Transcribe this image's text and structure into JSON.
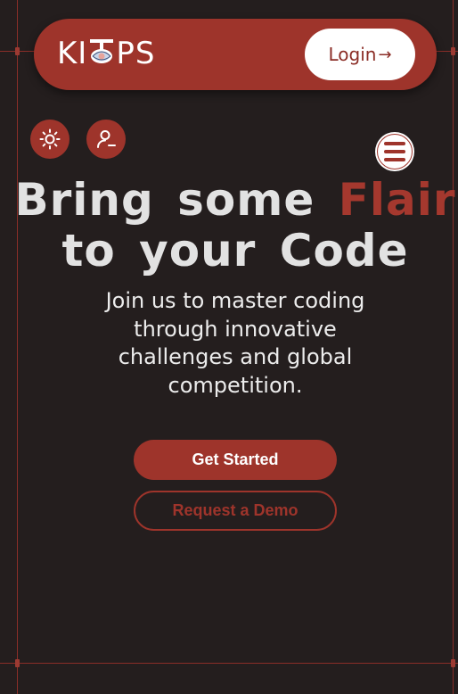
{
  "brand": {
    "logo_left": "KI",
    "logo_right": "PS"
  },
  "header": {
    "login_label": "Login",
    "login_arrow": "→"
  },
  "controls": {
    "theme_icon": "sun-icon",
    "profile_icon": "user-icon",
    "menu_icon": "hamburger-icon"
  },
  "hero": {
    "title_line1_prefix": "Bring some",
    "title_line1_accent": "Flair",
    "title_line2": "to your Code",
    "subtitle": "Join us to master coding through innovative challenges and global competition."
  },
  "cta": {
    "primary_label": "Get Started",
    "secondary_label": "Request a Demo"
  },
  "colors": {
    "background": "#241e1e",
    "accent": "#9e342b",
    "text": "#e2e2e2"
  }
}
